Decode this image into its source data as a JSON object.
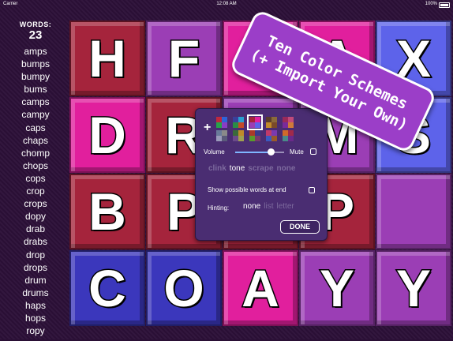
{
  "status_bar": {
    "carrier": "Carrier",
    "time": "12:08 AM",
    "battery": "100%"
  },
  "words_panel": {
    "label": "WORDS:",
    "count": "23",
    "words": [
      "amps",
      "bumps",
      "bumpy",
      "bums",
      "camps",
      "campy",
      "caps",
      "chaps",
      "chomp",
      "chops",
      "cops",
      "crop",
      "crops",
      "dopy",
      "drab",
      "drabs",
      "drop",
      "drops",
      "drum",
      "drums",
      "haps",
      "hops",
      "ropy"
    ]
  },
  "colors": {
    "red": "#a5243c",
    "pink": "#e11f9d",
    "purple": "#9b3eb5",
    "blue": "#3b37bc",
    "periwinkle": "#5d63ea"
  },
  "board": {
    "tiles": [
      {
        "letter": "H",
        "color": "#a5243c"
      },
      {
        "letter": "F",
        "color": "#9b3eb5"
      },
      {
        "letter": "",
        "color": "#e11f9d"
      },
      {
        "letter": "A",
        "color": "#e11f9d"
      },
      {
        "letter": "X",
        "color": "#5d63ea"
      },
      {
        "letter": "D",
        "color": "#e11f9d"
      },
      {
        "letter": "R",
        "color": "#a5243c"
      },
      {
        "letter": "",
        "color": "#9b3eb5"
      },
      {
        "letter": "M",
        "color": "#9b3eb5"
      },
      {
        "letter": "S",
        "color": "#5d63ea"
      },
      {
        "letter": "B",
        "color": "#a5243c"
      },
      {
        "letter": "P",
        "color": "#a5243c"
      },
      {
        "letter": "",
        "color": "#a5243c"
      },
      {
        "letter": "P",
        "color": "#a5243c"
      },
      {
        "letter": "",
        "color": "#9b3eb5"
      },
      {
        "letter": "C",
        "color": "#3b37bc"
      },
      {
        "letter": "O",
        "color": "#3b37bc"
      },
      {
        "letter": "A",
        "color": "#e11f9d"
      },
      {
        "letter": "Y",
        "color": "#9b3eb5"
      },
      {
        "letter": "Y",
        "color": "#9b3eb5"
      }
    ]
  },
  "banner": {
    "line1": "Ten Color Schemes",
    "line2": "(+ Import Your Own)"
  },
  "settings": {
    "add_icon": "plus-icon",
    "schemes": [
      [
        "#c0283e",
        "#2e63d8",
        "#27a24a",
        "#8b3cc4"
      ],
      [
        "#3a3f9c",
        "#2a9fd0",
        "#2a8d45",
        "#c34b2a"
      ],
      [
        "#a5243c",
        "#e11f9d",
        "#9b3eb5",
        "#5d63ea"
      ],
      [
        "#5a3d2a",
        "#8b6a3a",
        "#c08a2a",
        "#7a4a2a"
      ],
      [
        "#9a2a5a",
        "#c04a7a",
        "#7a2a9a",
        "#d07a3a"
      ],
      [
        "#6a7a9a",
        "#8a8a8a",
        "#9a9aba",
        "#5a5a7a"
      ],
      [
        "#3a6a3a",
        "#c08a2a",
        "#6a4a8a",
        "#a0a050"
      ],
      [
        "#aa3a2a",
        "#3a3a8a",
        "#5a9a2a",
        "#7a3a6a"
      ],
      [
        "#c03a6a",
        "#7a3ab0",
        "#3a5ac0",
        "#9a5a2a"
      ],
      [
        "#d06a2a",
        "#a02a4a",
        "#4a8a8a",
        "#6a2a8a"
      ]
    ],
    "selected_scheme": 2,
    "volume_label": "Volume",
    "volume_level": 0.72,
    "mute_label": "Mute",
    "sounds": [
      "clink",
      "tone",
      "scrape",
      "none"
    ],
    "selected_sound": "tone",
    "show_words_label": "Show possible words at end",
    "hinting_label": "Hinting:",
    "hint_options": [
      "none",
      "list",
      "letter"
    ],
    "selected_hint": "none",
    "done_label": "DONE"
  }
}
